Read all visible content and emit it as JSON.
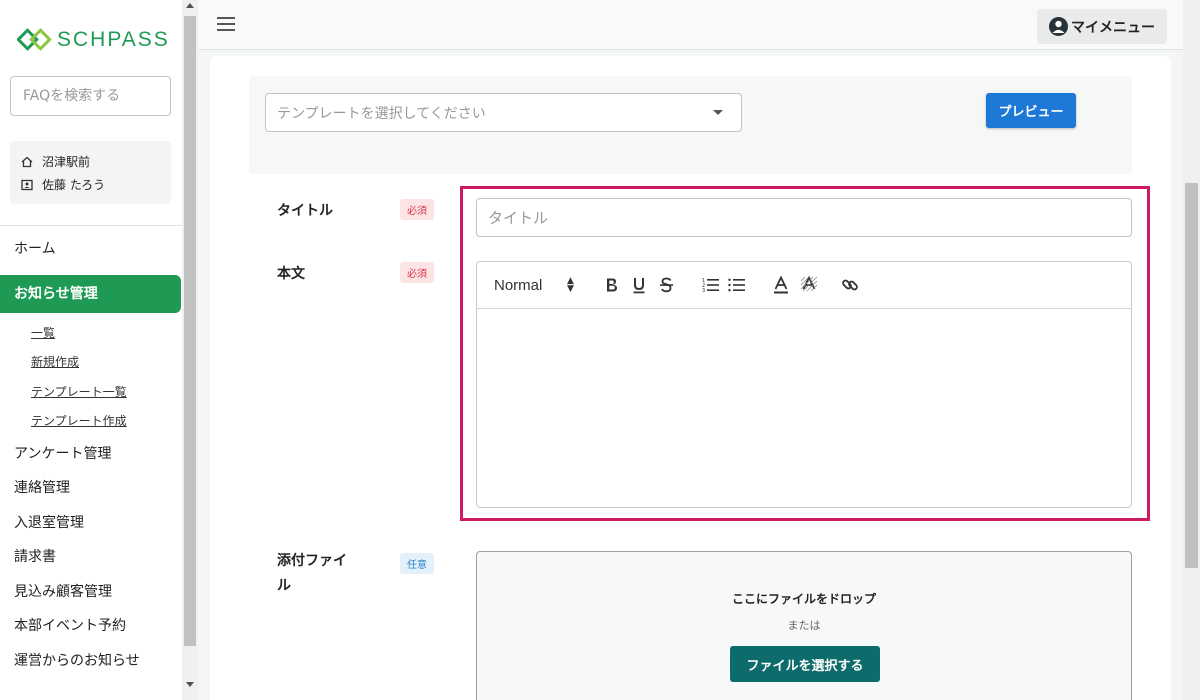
{
  "app": {
    "logo_text": "SCHPASS",
    "brand_color": "#1f9a55"
  },
  "sidebar": {
    "faq_search_placeholder": "FAQを検索する",
    "info": {
      "school": "沼津駅前",
      "user": "佐藤 たろう"
    },
    "nav": [
      {
        "label": "ホーム"
      },
      {
        "label": "お知らせ管理",
        "active": true
      },
      {
        "label": "アンケート管理"
      },
      {
        "label": "連絡管理"
      },
      {
        "label": "入退室管理"
      },
      {
        "label": "請求書"
      },
      {
        "label": "見込み顧客管理"
      },
      {
        "label": "本部イベント予約"
      },
      {
        "label": "運営からのお知らせ"
      }
    ],
    "sub_nav": [
      {
        "label": "一覧"
      },
      {
        "label": "新規作成"
      },
      {
        "label": "テンプレート一覧"
      },
      {
        "label": "テンプレート作成"
      }
    ]
  },
  "header": {
    "my_menu_label": "マイメニュー"
  },
  "form": {
    "template_placeholder": "テンプレートを選択してください",
    "preview_label": "プレビュー",
    "title_label": "タイトル",
    "title_placeholder": "タイトル",
    "body_label": "本文",
    "required_badge": "必須",
    "optional_badge": "任意",
    "attach_label": "添付ファイル",
    "editor": {
      "format_value": "Normal"
    },
    "dropzone": {
      "title": "ここにファイルをドロップ",
      "or": "または",
      "select_button": "ファイルを選択する"
    }
  },
  "colors": {
    "highlight": "#cc1a63",
    "primary_blue": "#1e78d6",
    "teal": "#0e6b6b",
    "required_red": "#d9364a"
  }
}
